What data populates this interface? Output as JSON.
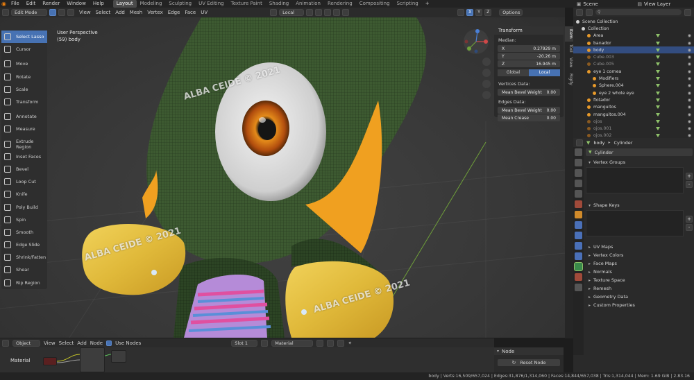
{
  "menu": {
    "items": [
      "File",
      "Edit",
      "Render",
      "Window",
      "Help"
    ],
    "workspaces": [
      "Layout",
      "Modeling",
      "Sculpting",
      "UV Editing",
      "Texture Paint",
      "Shading",
      "Animation",
      "Rendering",
      "Compositing",
      "Scripting"
    ],
    "active_workspace": "Layout",
    "scene": "Scene",
    "view_layer": "View Layer"
  },
  "viewport_header": {
    "mode": "Edit Mode",
    "menus": [
      "View",
      "Select",
      "Add",
      "Mesh",
      "Vertex",
      "Edge",
      "Face",
      "UV"
    ],
    "pivot": "Local",
    "axes": [
      "X",
      "Y",
      "Z"
    ],
    "options": "Options"
  },
  "viewport": {
    "perspective": "User Perspective",
    "object_label": "(59) body",
    "watermark": "ALBA CEIDE © 2021"
  },
  "toolbar": [
    {
      "label": "Select Lasso",
      "icon": "lasso-icon",
      "active": true
    },
    {
      "label": "Cursor",
      "icon": "cursor-icon"
    },
    {
      "label": "Move",
      "icon": "move-icon"
    },
    {
      "label": "Rotate",
      "icon": "rotate-icon"
    },
    {
      "label": "Scale",
      "icon": "scale-icon"
    },
    {
      "label": "Transform",
      "icon": "transform-icon"
    },
    {
      "label": "Annotate",
      "icon": "annotate-icon"
    },
    {
      "label": "Measure",
      "icon": "measure-icon"
    },
    {
      "label": "Extrude Region",
      "icon": "extrude-icon"
    },
    {
      "label": "Inset Faces",
      "icon": "inset-icon"
    },
    {
      "label": "Bevel",
      "icon": "bevel-icon"
    },
    {
      "label": "Loop Cut",
      "icon": "loop-cut-icon"
    },
    {
      "label": "Knife",
      "icon": "knife-icon"
    },
    {
      "label": "Poly Build",
      "icon": "poly-build-icon"
    },
    {
      "label": "Spin",
      "icon": "spin-icon"
    },
    {
      "label": "Smooth",
      "icon": "smooth-icon"
    },
    {
      "label": "Edge Slide",
      "icon": "edge-slide-icon"
    },
    {
      "label": "Shrink/Fatten",
      "icon": "shrink-icon"
    },
    {
      "label": "Shear",
      "icon": "shear-icon"
    },
    {
      "label": "Rip Region",
      "icon": "rip-icon"
    }
  ],
  "transform_panel": {
    "title": "Transform",
    "median_label": "Median:",
    "x_label": "X",
    "x_value": "0.27929 m",
    "y_label": "Y",
    "y_value": "-20.26 m",
    "z_label": "Z",
    "z_value": "16.945 m",
    "global_label": "Global",
    "local_label": "Local",
    "vertices_data": "Vertices Data:",
    "vertex_bevel_label": "Mean Bevel Weight",
    "vertex_bevel_value": "0.00",
    "edges_data": "Edges Data:",
    "edge_bevel_label": "Mean Bevel Weight",
    "edge_bevel_value": "0.00",
    "crease_label": "Mean Crease",
    "crease_value": "0.00"
  },
  "n_tabs": [
    "Item",
    "Tool",
    "View",
    "Rigify"
  ],
  "outliner": {
    "rows": [
      {
        "label": "Scene Collection",
        "indent": 0
      },
      {
        "label": "Collection",
        "indent": 1
      },
      {
        "label": "Area",
        "indent": 2
      },
      {
        "label": "banador",
        "indent": 2
      },
      {
        "label": "body",
        "indent": 2,
        "selected": true
      },
      {
        "label": "Cube.003",
        "indent": 2,
        "dim": true
      },
      {
        "label": "Cube.005",
        "indent": 2,
        "dim": true
      },
      {
        "label": "eye 1 cornea",
        "indent": 2
      },
      {
        "label": "Modifiers",
        "indent": 3
      },
      {
        "label": "Sphere.004",
        "indent": 3
      },
      {
        "label": "eye 2 whole eye",
        "indent": 3
      },
      {
        "label": "flotador",
        "indent": 2
      },
      {
        "label": "manguitos",
        "indent": 2
      },
      {
        "label": "manguitos.004",
        "indent": 2
      },
      {
        "label": "ojos",
        "indent": 2,
        "dim": true
      },
      {
        "label": "ojos.001",
        "indent": 2,
        "dim": true
      },
      {
        "label": "ojos.002",
        "indent": 2,
        "dim": true
      }
    ]
  },
  "properties": {
    "object": "body",
    "data_name": "Cylinder",
    "mesh_name": "Cylinder",
    "vertex_groups": "Vertex Groups",
    "shape_keys": "Shape Keys",
    "sections": [
      "UV Maps",
      "Vertex Colors",
      "Face Maps",
      "Normals",
      "Texture Space",
      "Remesh",
      "Geometry Data",
      "Custom Properties"
    ]
  },
  "shader_header": {
    "editor": "Object",
    "menus": [
      "View",
      "Select",
      "Add",
      "Node"
    ],
    "use_nodes_label": "Use Nodes",
    "slot": "Slot 1",
    "material": "Material"
  },
  "shader_area": {
    "material_label": "Material"
  },
  "node_panel": {
    "title": "Node",
    "reset": "Reset Node"
  },
  "statusbar": {
    "text": "body | Verts:16,509/657,024 | Edges:31,876/1,314,060 | Faces:14,844/657,038 | Tris:1,314,044 | Mem: 1.69 GiB | 2.83.16"
  },
  "colors": {
    "accent": "#4772b3",
    "selected_row": "#334d80",
    "mesh_green": "#3c5a2f",
    "selection_orange": "#f0a020"
  }
}
